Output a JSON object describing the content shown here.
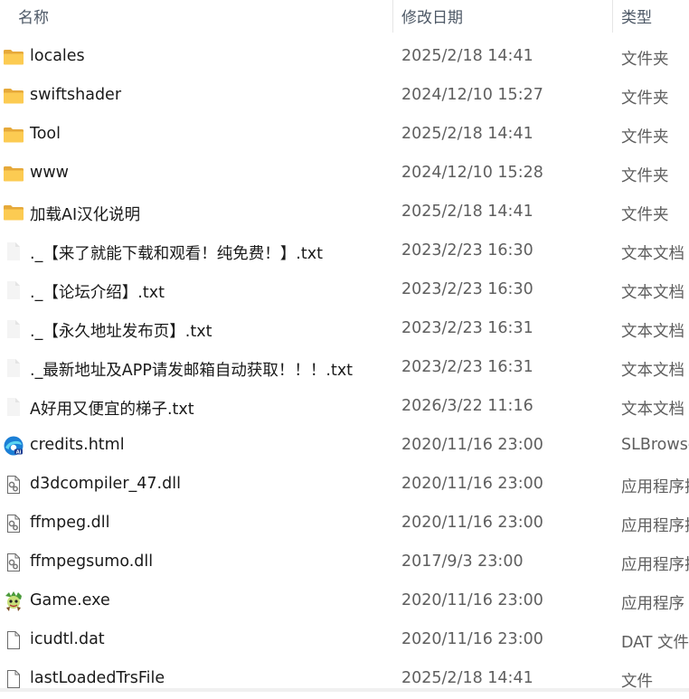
{
  "columns": {
    "name": "名称",
    "date": "修改日期",
    "type": "类型"
  },
  "files": [
    {
      "name": "locales",
      "date": "2025/2/18 14:41",
      "type": "文件夹",
      "icon": "folder-icon"
    },
    {
      "name": "swiftshader",
      "date": "2024/12/10 15:27",
      "type": "文件夹",
      "icon": "folder-icon"
    },
    {
      "name": "Tool",
      "date": "2025/2/18 14:41",
      "type": "文件夹",
      "icon": "folder-icon"
    },
    {
      "name": "www",
      "date": "2024/12/10 15:28",
      "type": "文件夹",
      "icon": "folder-icon"
    },
    {
      "name": "加载AI汉化说明",
      "date": "2025/2/18 14:41",
      "type": "文件夹",
      "icon": "folder-icon"
    },
    {
      "name": "._【来了就能下载和观看！纯免费！】.txt",
      "date": "2023/2/23 16:30",
      "type": "文本文档",
      "icon": "text-file-icon"
    },
    {
      "name": "._【论坛介绍】.txt",
      "date": "2023/2/23 16:30",
      "type": "文本文档",
      "icon": "text-file-icon"
    },
    {
      "name": "._【永久地址发布页】.txt",
      "date": "2023/2/23 16:31",
      "type": "文本文档",
      "icon": "text-file-icon"
    },
    {
      "name": "._最新地址及APP请发邮箱自动获取！！！.txt",
      "date": "2023/2/23 16:31",
      "type": "文本文档",
      "icon": "text-file-icon"
    },
    {
      "name": "A好用又便宜的梯子.txt",
      "date": "2026/3/22 11:16",
      "type": "文本文档",
      "icon": "text-file-icon"
    },
    {
      "name": "credits.html",
      "date": "2020/11/16 23:00",
      "type": "SLBrowse",
      "icon": "browser-icon"
    },
    {
      "name": "d3dcompiler_47.dll",
      "date": "2020/11/16 23:00",
      "type": "应用程序扩",
      "icon": "dll-file-icon"
    },
    {
      "name": "ffmpeg.dll",
      "date": "2020/11/16 23:00",
      "type": "应用程序扩",
      "icon": "dll-file-icon"
    },
    {
      "name": "ffmpegsumo.dll",
      "date": "2017/9/3 23:00",
      "type": "应用程序扩",
      "icon": "dll-file-icon"
    },
    {
      "name": "Game.exe",
      "date": "2020/11/16 23:00",
      "type": "应用程序",
      "icon": "game-exe-icon"
    },
    {
      "name": "icudtl.dat",
      "date": "2020/11/16 23:00",
      "type": "DAT 文件",
      "icon": "blank-file-icon"
    },
    {
      "name": "lastLoadedTrsFile",
      "date": "2025/2/18 14:41",
      "type": "文件",
      "icon": "blank-file-icon"
    }
  ]
}
